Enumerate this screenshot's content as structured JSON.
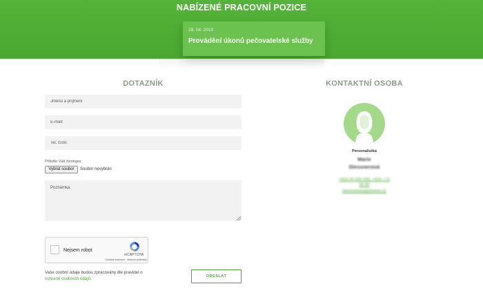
{
  "hero": {
    "title": "NABÍZENÉ PRACOVNÍ POZICE",
    "job": {
      "date": "29. 04. 2019",
      "title": "Provádění úkonů pečovatelské služby"
    }
  },
  "form": {
    "heading": "DOTAZNÍK",
    "name_placeholder": "Jméno a příjmení",
    "email_placeholder": "E-mail:",
    "phone_placeholder": "Tel. číslo:",
    "cv_label": "Přiložte Váš životopis:",
    "file_button": "Vybrat soubor",
    "file_status": "Soubor nevybrán",
    "notes_placeholder": "Poznámka:",
    "captcha": {
      "label": "Nejsem robot",
      "brand": "reCAPTCHA",
      "links": "Ochrana soukromí · Smluvní podmínky"
    },
    "consent_text": "Vaše osobní údaje budou zpracovány dle pravidel o",
    "consent_link": "ochraně osobních údajů",
    "consent_end": ".",
    "submit_label": "ODESLAT"
  },
  "contact": {
    "heading": "KONTAKTNÍ OSOBA",
    "role": "Personalistka",
    "name_first": "Marie",
    "name_last": "Diessnerová",
    "phone": "+420 00 000 000, +420 775 00 00",
    "email": "diessnerova@domov.cz"
  },
  "colors": {
    "brand_green": "#4aa72f",
    "card_green": "#6cc24f",
    "avatar_green": "#a5d98a",
    "field_bg": "#f2f2f2",
    "heading_grey": "#8a9a8a"
  }
}
